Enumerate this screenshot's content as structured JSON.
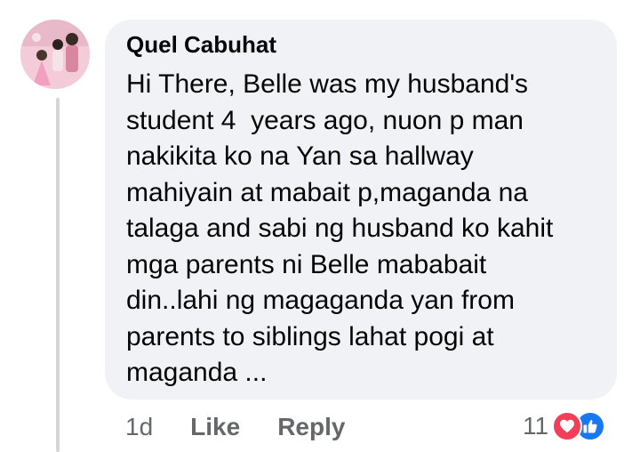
{
  "comment": {
    "author": "Quel Cabuhat",
    "text_lines": [
      "Hi There, Belle was my husband's",
      "student 4  years ago, nuon p man",
      "nakikita ko na Yan sa hallway",
      "mahiyain at mabait p,maganda na",
      "talaga and sabi ng husband ko kahit",
      "mga parents ni Belle mababait",
      "din..lahi ng magaganda yan from",
      "parents to siblings lahat pogi at",
      "maganda ..."
    ],
    "time": "1d",
    "like_label": "Like",
    "reply_label": "Reply",
    "reaction_count": "11",
    "reaction_icons": [
      "heart-icon",
      "thumbs-up-icon"
    ]
  },
  "colors": {
    "bubble_bg": "#f0f2f5",
    "text": "#050505",
    "meta_text": "#65676b",
    "heart_red": "#f33e58",
    "like_blue": "#1877f2",
    "thread_line": "#d4d6da"
  }
}
